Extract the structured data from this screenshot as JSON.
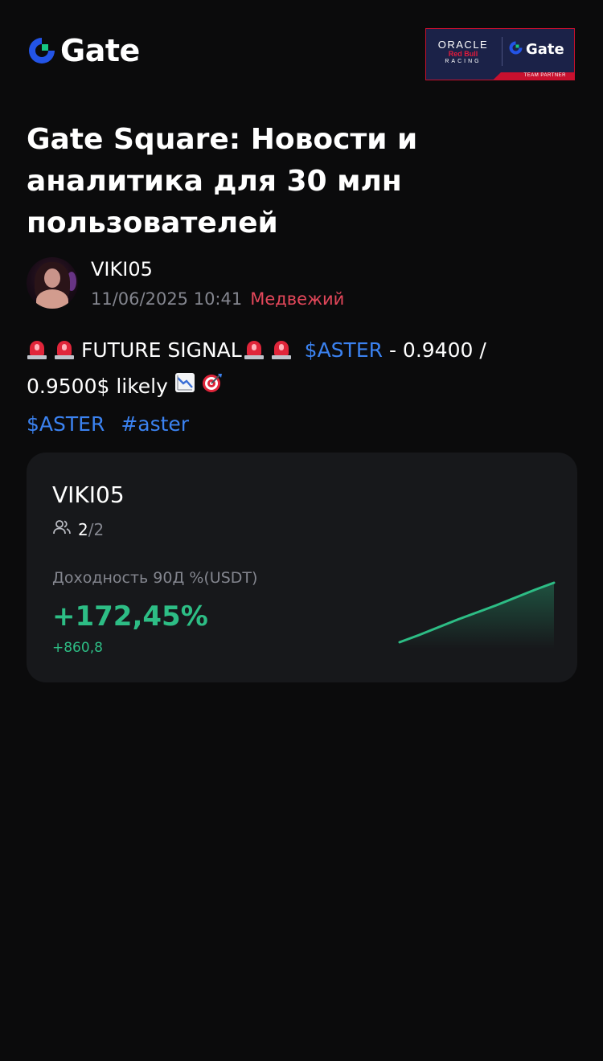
{
  "header": {
    "brand": "Gate",
    "partner": {
      "oracle": "ORACLE",
      "redbull": "Red Bull",
      "racing": "RACING",
      "gate": "Gate",
      "strip": "TEAM PARTNER"
    }
  },
  "title": "Gate Square: Новости и аналитика для 30 млн пользователей",
  "post": {
    "username": "VIKI05",
    "timestamp": "11/06/2025 10:41",
    "sentiment": "Медвежий",
    "signal_text": "FUTURE SIGNAL",
    "ticker": "$ASTER",
    "line1_rest": " - 0.9400 /",
    "line2": "0.9500$ likely ",
    "tags": [
      "$ASTER",
      "#aster"
    ]
  },
  "card": {
    "name": "VIKI05",
    "followers_current": "2",
    "followers_max": "2",
    "return_label": "Доходность 90Д %(USDT)",
    "return_value": "+172,45%",
    "pnl": "+860,8",
    "sparkline": [
      0,
      0.12,
      0.25,
      0.38,
      0.5,
      0.62,
      0.75,
      0.88,
      1.0
    ]
  },
  "colors": {
    "background": "#0b0b0c",
    "card": "#17181b",
    "accent_blue": "#3b82f0",
    "bearish": "#e3475a",
    "positive": "#2dbd85",
    "muted": "#84868f"
  },
  "icons": {
    "brand": "gate-logo-icon",
    "siren": "siren-emoji-icon",
    "chart_down": "chart-decreasing-emoji-icon",
    "target": "direct-hit-emoji-icon",
    "followers": "users-icon"
  }
}
